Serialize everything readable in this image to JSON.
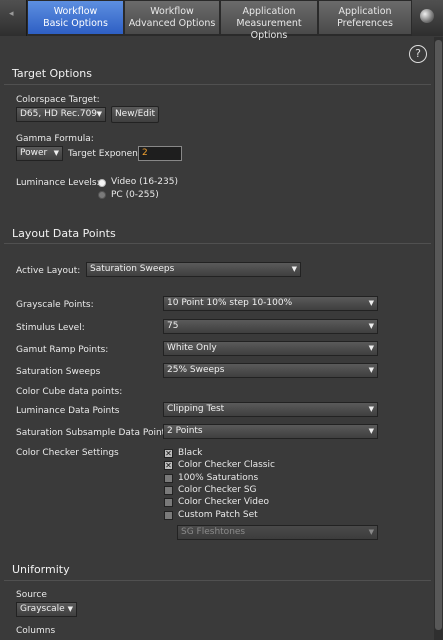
{
  "tabs": [
    {
      "line1": "Workflow",
      "line2": "Basic Options",
      "active": true
    },
    {
      "line1": "Workflow",
      "line2": "Advanced Options",
      "active": false
    },
    {
      "line1": "Application",
      "line2": "Measurement Options",
      "active": false
    },
    {
      "line1": "Application",
      "line2": "Preferences",
      "active": false
    }
  ],
  "help_glyph": "?",
  "target_options": {
    "title": "Target Options",
    "colorspace_label": "Colorspace Target:",
    "colorspace_value": "D65, HD Rec.709",
    "new_edit_label": "New/Edit",
    "gamma_label": "Gamma Formula:",
    "gamma_value": "Power",
    "target_exponent_label": "Target Exponent",
    "target_exponent_value": "2",
    "luminance_label": "Luminance Levels:",
    "luminance_options": [
      "Video (16-235)",
      "PC (0-255)"
    ],
    "luminance_selected": 0
  },
  "layout": {
    "title": "Layout Data Points",
    "active_layout_label": "Active Layout:",
    "active_layout_value": "Saturation Sweeps",
    "grayscale_label": "Grayscale Points:",
    "grayscale_value": "10 Point 10% step 10-100%",
    "stimulus_label": "Stimulus Level:",
    "stimulus_value": "75",
    "gamut_label": "Gamut Ramp Points:",
    "gamut_value": "White Only",
    "saturation_label": "Saturation Sweeps",
    "saturation_value": "25% Sweeps",
    "color_cube_label": "Color Cube data points:",
    "luminance_dp_label": "Luminance Data Points",
    "luminance_dp_value": "Clipping Test",
    "sat_subsample_label": "Saturation Subsample Data Points",
    "sat_subsample_value": "2 Points",
    "color_checker_label": "Color Checker Settings",
    "checkers": [
      {
        "label": "Black",
        "checked": true
      },
      {
        "label": "Color Checker Classic",
        "checked": true
      },
      {
        "label": "100% Saturations",
        "checked": false
      },
      {
        "label": "Color Checker SG",
        "checked": false
      },
      {
        "label": "Color Checker Video",
        "checked": false
      },
      {
        "label": "Custom Patch Set",
        "checked": false
      }
    ],
    "custom_patch_value": "SG Fleshtones"
  },
  "uniformity": {
    "title": "Uniformity",
    "source_label": "Source",
    "source_value": "Grayscale",
    "columns_label": "Columns"
  },
  "colors": {
    "accent": "#2e5fc4",
    "field_text": "#f0a030",
    "background": "#3a3a3a"
  }
}
